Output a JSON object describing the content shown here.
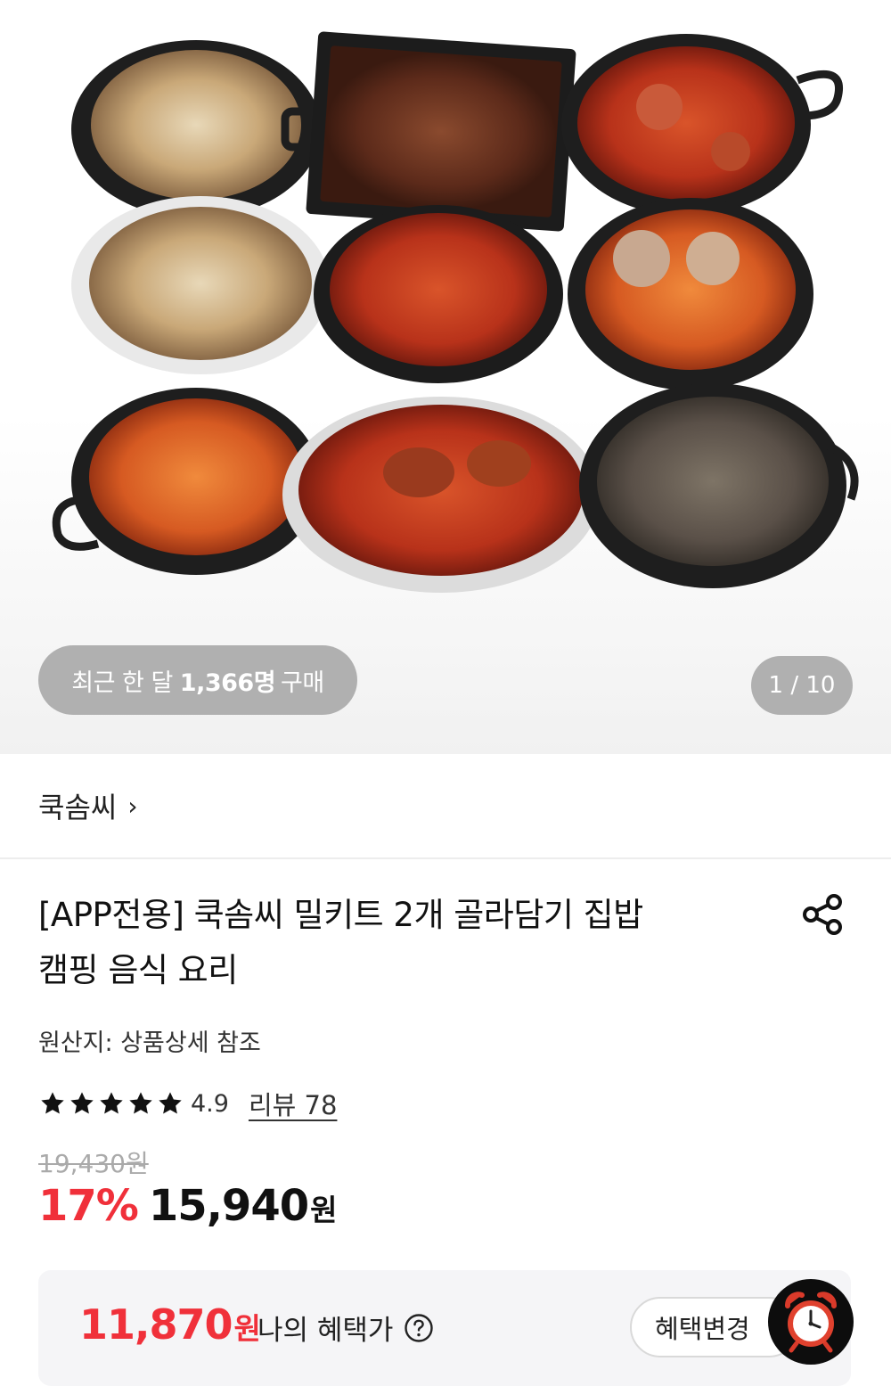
{
  "gallery": {
    "purchase_badge": {
      "prefix": "최근 한 달",
      "count": "1,366명",
      "suffix": "구매"
    },
    "counter": "1 / 10",
    "current_index": 1,
    "total": 10
  },
  "seller": {
    "name": "쿡솜씨",
    "chevron": "›"
  },
  "product": {
    "title_line1": "[APP전용] 쿡솜씨 밀키트 2개 골라담기 집밥",
    "title_line2": "캠핑 음식 요리",
    "origin": "원산지: 상품상세 참조",
    "rating": "4.9",
    "rating_stars": 5,
    "review_label": "리뷰 78",
    "original_price": "19,430원",
    "discount": "17%",
    "price": "15,940",
    "price_unit": "원"
  },
  "benefit": {
    "price": "11,870",
    "price_unit": "원",
    "label": "나의 혜택가",
    "change_button": "혜택변경"
  },
  "colors": {
    "accent_red": "#f0303a",
    "badge_gray": "#969696",
    "benefit_bg": "#f5f5f7"
  },
  "icons": {
    "share": "share-icon",
    "star": "star-icon",
    "help": "question-circle-icon",
    "alarm": "alarm-clock-icon"
  }
}
